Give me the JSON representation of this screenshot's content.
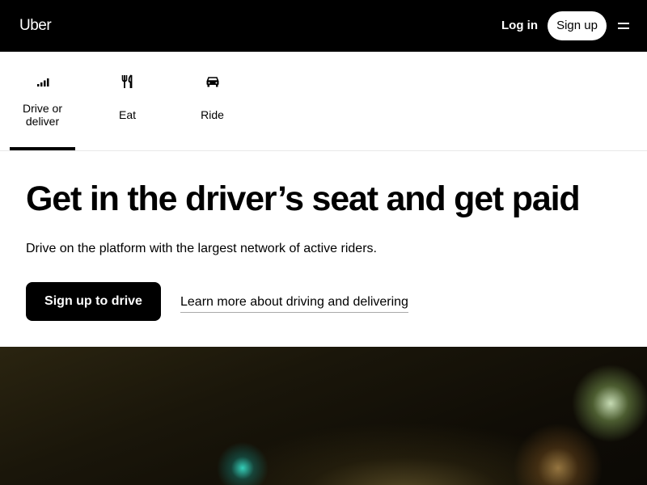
{
  "header": {
    "logo": "Uber",
    "login_label": "Log in",
    "signup_label": "Sign up"
  },
  "tabs": [
    {
      "label": "Drive or deliver",
      "icon": "signal-bars-icon",
      "selected": true
    },
    {
      "label": "Eat",
      "icon": "fork-knife-icon",
      "selected": false
    },
    {
      "label": "Ride",
      "icon": "car-icon",
      "selected": false
    }
  ],
  "main": {
    "headline": "Get in the driver’s seat and get paid",
    "subtitle": "Drive on the platform with the largest network of active riders.",
    "cta_label": "Sign up to drive",
    "learn_more_label": "Learn more about driving and delivering"
  },
  "colors": {
    "header_bg": "#000000",
    "cta_bg": "#000000",
    "text": "#000000"
  }
}
